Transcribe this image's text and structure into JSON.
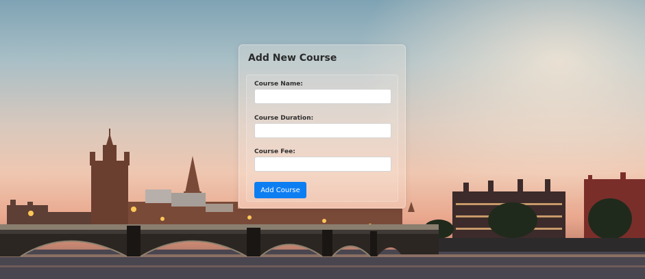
{
  "form": {
    "title": "Add New Course",
    "fields": [
      {
        "label": "Course Name:",
        "value": "",
        "placeholder": ""
      },
      {
        "label": "Course Duration:",
        "value": "",
        "placeholder": ""
      },
      {
        "label": "Course Fee:",
        "value": "",
        "placeholder": ""
      }
    ],
    "submit_label": "Add Course"
  },
  "colors": {
    "button": "#0d7ef2",
    "sky_top": "#7fa3b4",
    "sky_sunset": "#efc7b1",
    "river": "#4f4a52"
  }
}
